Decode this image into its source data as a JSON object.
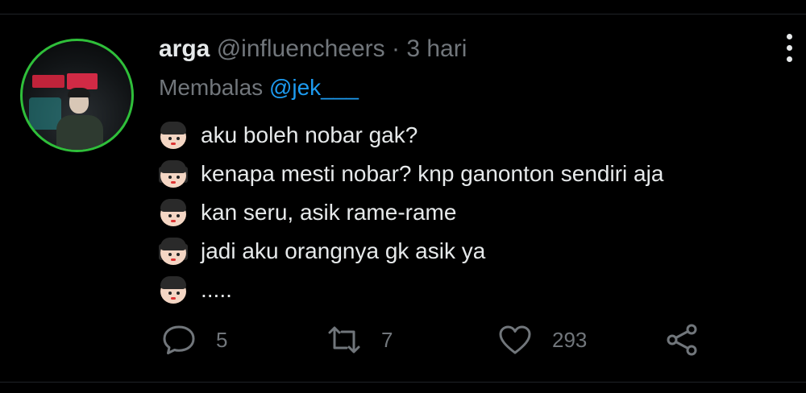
{
  "tweet": {
    "display_name": "arga",
    "handle": "@influencheers",
    "separator": "·",
    "time": "3 hari",
    "reply_prefix": "Membalas",
    "reply_to": "@jek___",
    "lines": [
      {
        "emoji": "boy-face",
        "text": "aku boleh nobar gak?"
      },
      {
        "emoji": "girl-face",
        "text": "kenapa mesti nobar? knp ganonton sendiri aja"
      },
      {
        "emoji": "boy-face",
        "text": "kan seru, asik rame-rame"
      },
      {
        "emoji": "girl-face",
        "text": "jadi aku orangnya gk asik ya"
      },
      {
        "emoji": "boy-face",
        "text": "....."
      }
    ]
  },
  "actions": {
    "replies": "5",
    "retweets": "7",
    "likes": "293"
  },
  "colors": {
    "background": "#000000",
    "text": "#e6e9ea",
    "muted": "#71767b",
    "link": "#1d9bf0",
    "avatar_ring": "#2fbf3a"
  }
}
